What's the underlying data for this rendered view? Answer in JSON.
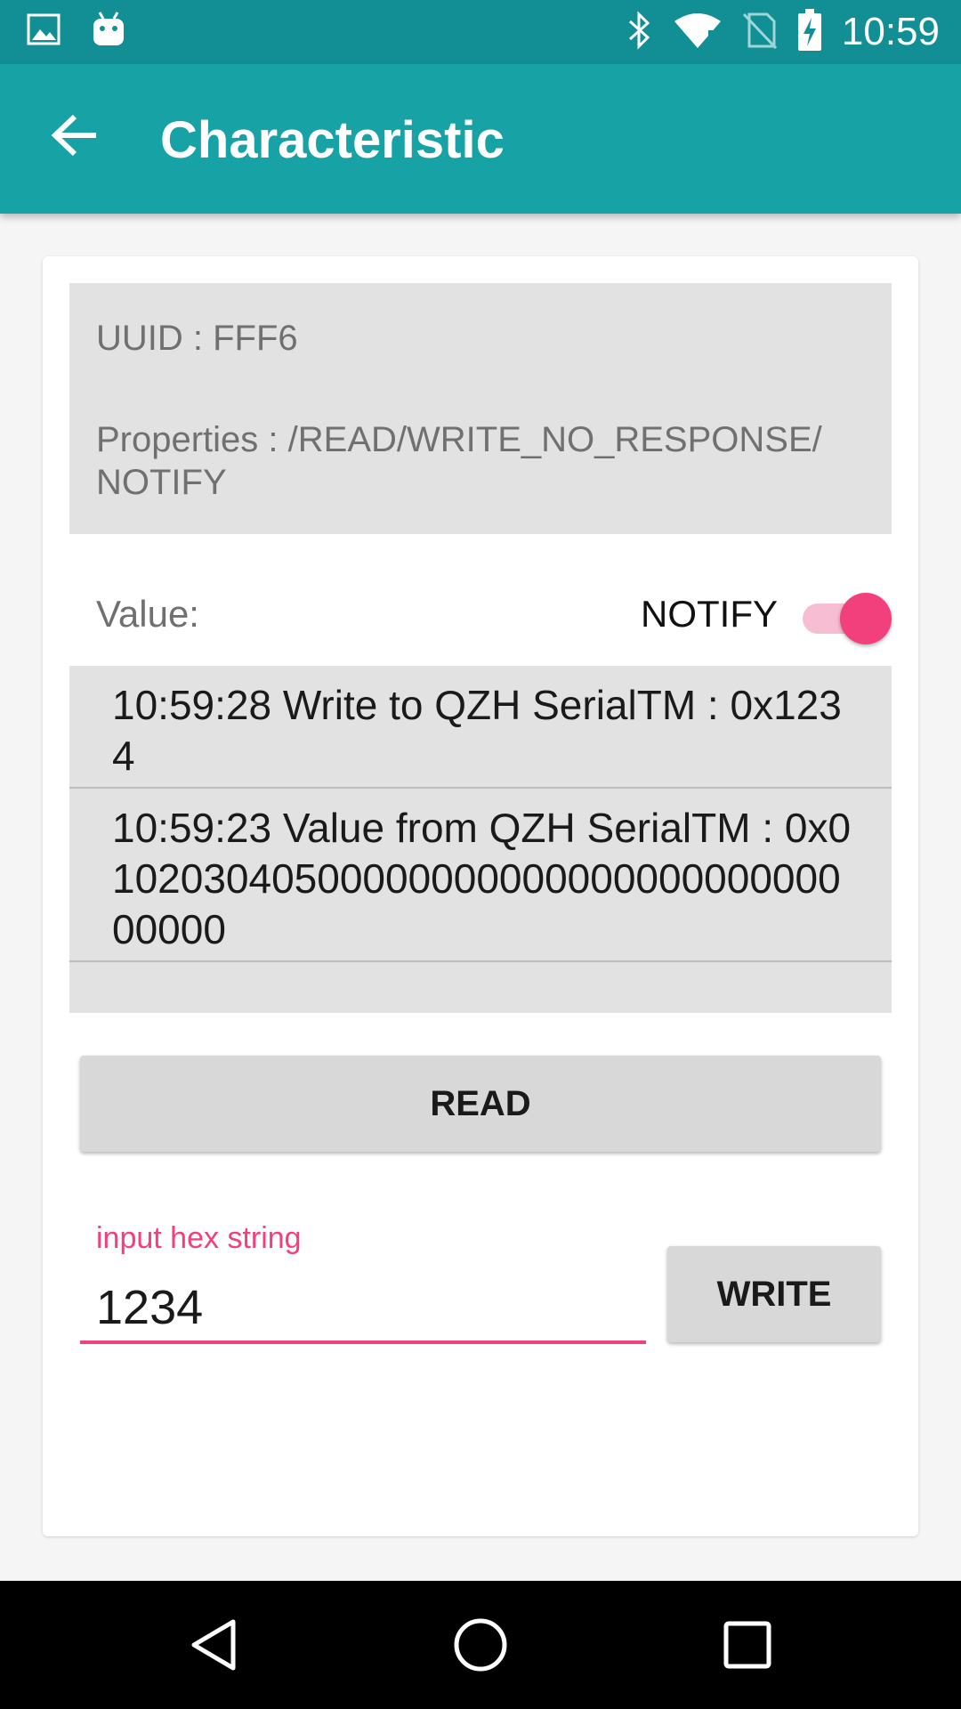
{
  "status_bar": {
    "time": "10:59",
    "left_icons": [
      "image-icon",
      "android-icon"
    ],
    "right_icons": [
      "bluetooth-icon",
      "wifi-icon",
      "no-sim-icon",
      "battery-charging-icon"
    ]
  },
  "app_bar": {
    "title": "Characteristic",
    "back_icon": "arrow-back-icon",
    "color": "#17a2a6"
  },
  "info": {
    "uuid": "UUID : FFF6",
    "properties": "Properties : /READ/WRITE_NO_RESPONSE/ NOTIFY"
  },
  "value_section": {
    "label": "Value:",
    "notify_label": "NOTIFY",
    "notify_on": true,
    "accent": "#f2407c"
  },
  "log": [
    {
      "text": "10:59:28 Write to QZH SerialTM : 0x1234"
    },
    {
      "text": "10:59:23 Value from QZH SerialTM : 0x01020304050000000000000000000000000000"
    }
  ],
  "read_button": {
    "label": "READ"
  },
  "write_section": {
    "label": "input hex string",
    "value": "1234",
    "button_label": "WRITE"
  },
  "nav": {
    "icons": [
      "back-triangle-icon",
      "home-circle-icon",
      "recents-square-icon"
    ]
  }
}
